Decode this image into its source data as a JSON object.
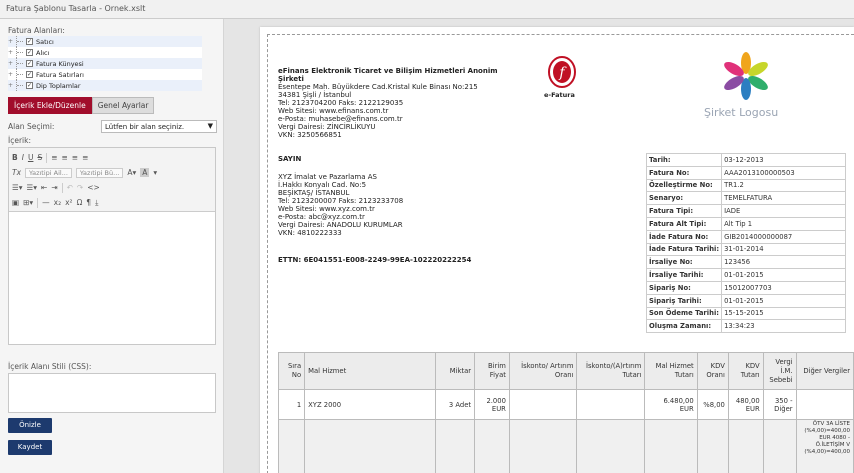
{
  "window_title": "Fatura Şablonu Tasarla - Ornek.xslt",
  "left": {
    "fields_label": "Fatura Alanları:",
    "tree": [
      "Satıcı",
      "Alıcı",
      "Fatura Künyesi",
      "Fatura Satırları",
      "Dip Toplamlar"
    ],
    "tab_active": "İçerik Ekle/Düzenle",
    "tab_other": "Genel Ayarlar",
    "alan_label": "Alan Seçimi:",
    "alan_value": "Lütfen bir alan seçiniz.",
    "icerik_label": "İçerik:",
    "font_dd": "Yazıtipi Ail...",
    "size_dd": "Yazıtipi Bü...",
    "css_label": "İçerik Alanı Stili (CSS):",
    "btn_preview": "Önizle",
    "btn_save": "Kaydet"
  },
  "seller": {
    "lines": [
      "eFinans Elektronik Ticaret ve Bilişim Hizmetleri Anonim",
      "Şirketi",
      "Esentepe Mah. Büyükdere Cad.Kristal Kule Binası No:215",
      "34381 Şişli / İstanbul",
      "Tel: 2123704200 Faks: 2122129035",
      "Web Sitesi: www.efinans.com.tr",
      "e-Posta: muhasebe@efinans.com.tr",
      "Vergi Dairesi: ZİNCİRLİKUYU",
      "VKN: 3250566851"
    ]
  },
  "buyer": {
    "title": "SAYIN",
    "lines": [
      "XYZ İmalat ve Pazarlama AS",
      "İ.Hakkı Konyalı Cad.  No:5",
      "BEŞİKTAŞ/ İSTANBUL",
      "Tel: 2123200007 Faks: 2123233708",
      "Web Sitesi: www.xyz.com.tr",
      "e-Posta: abc@xyz.com.tr",
      "Vergi Dairesi: ANADOLU KURUMLAR",
      "VKN: 4810222333"
    ]
  },
  "ettn": "ETTN: 6E041551-E008-2249-99EA-102220222254",
  "efatura_label": "e-Fatura",
  "company_logo": "Şirket Logosu",
  "info": [
    [
      "Tarih:",
      "03-12-2013"
    ],
    [
      "Fatura No:",
      "AAA2013100000503"
    ],
    [
      "Özelleştirme No:",
      "TR1.2"
    ],
    [
      "Senaryo:",
      "TEMELFATURA"
    ],
    [
      "Fatura Tipi:",
      "IADE"
    ],
    [
      "Fatura Alt Tipi:",
      "Alt Tip 1"
    ],
    [
      "İade Fatura No:",
      "GIB2014000000087"
    ],
    [
      "İade Fatura Tarihi:",
      "31-01-2014"
    ],
    [
      "İrsaliye No:",
      "123456"
    ],
    [
      "İrsaliye Tarihi:",
      "01-01-2015"
    ],
    [
      "Sipariş No:",
      "15012007703"
    ],
    [
      "Sipariş Tarihi:",
      "01-01-2015"
    ],
    [
      "Son Ödeme Tarihi:",
      "15-15-2015"
    ],
    [
      "Oluşma Zamanı:",
      "13:34:23"
    ]
  ],
  "items": {
    "headers": [
      "Sıra No",
      "Mal Hizmet",
      "Miktar",
      "Birim Fiyat",
      "İskonto/ Artırım Oranı",
      "İskonto/(A)rtırım Tutarı",
      "Mal Hizmet Tutarı",
      "KDV Oranı",
      "KDV Tutarı",
      "Vergi İ.M. Sebebi",
      "Diğer Vergiler"
    ],
    "row": [
      "1",
      "XYZ 2000",
      "3 Adet",
      "2.000 EUR",
      "",
      "",
      "6.480,00 EUR",
      "%8,00",
      "480,00 EUR",
      "350 - Diğer",
      ""
    ],
    "other_tax": "ÖTV 3A LİSTE (%4,00)=400,00 EUR 4080 - Ö.İLETİŞİM V (%4,00)=400,00"
  },
  "colors": {
    "accent": "#a10d2b",
    "button": "#1d3a6e"
  }
}
